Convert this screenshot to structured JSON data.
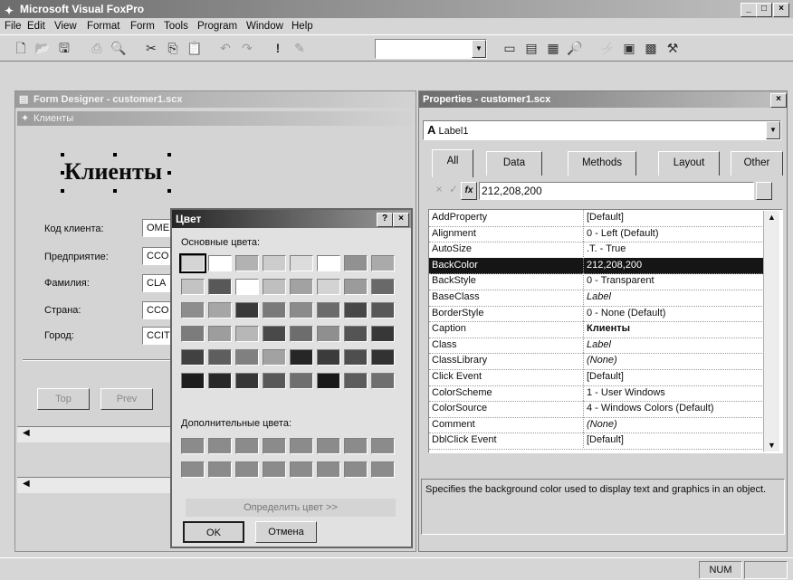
{
  "app": {
    "title": "Microsoft Visual FoxPro",
    "caption_buttons": [
      "_",
      "□",
      "×"
    ]
  },
  "menu": [
    "File",
    "Edit",
    "View",
    "Format",
    "Form",
    "Tools",
    "Program",
    "Window",
    "Help"
  ],
  "toolbar": {
    "icons": [
      "new-icon",
      "open-icon",
      "save-icon",
      "print-icon",
      "preview-icon",
      "cut-icon",
      "copy-icon",
      "paste-icon",
      "undo-icon",
      "redo-icon",
      "run-icon",
      "modify-icon"
    ],
    "combo_value": "",
    "right_icons": [
      "window-icon",
      "form-icon",
      "code-icon",
      "preview2-icon",
      "builder-icon",
      "data-env-icon",
      "properties-icon",
      "tools-icon"
    ]
  },
  "form_designer": {
    "title": "Form Designer - customer1.scx",
    "form_title": "Клиенты",
    "label_caption": "Клиенты",
    "fields": [
      {
        "label": "Код клиента:",
        "value": "OME"
      },
      {
        "label": "Предприятие:",
        "value": "CCO"
      },
      {
        "label": "Фамилия:",
        "value": "CLA"
      },
      {
        "label": "Страна:",
        "value": "CCO"
      },
      {
        "label": "Город:",
        "value": "CCIT"
      }
    ],
    "buttons": [
      "Top",
      "Prev"
    ]
  },
  "color_dialog": {
    "title": "Цвет",
    "help": "?",
    "close": "×",
    "basic_label": "Основные цвета:",
    "custom_label": "Дополнительные цвета:",
    "define_button": "Определить цвет >>",
    "ok": "OK",
    "cancel": "Отмена",
    "basic_colors": [
      "#d4d0c8",
      "#ffffff",
      "#b0b0b0",
      "#c8c8c8",
      "#d8d8d8",
      "#ffffff",
      "#909090",
      "#a8a8a8",
      "#c0c0c0",
      "#5a5a5a",
      "#ffffff",
      "#bcbcbc",
      "#a0a0a0",
      "#cfcfcf",
      "#9a9a9a",
      "#6a6a6a",
      "#8c8c8c",
      "#a4a4a4",
      "#3c3c3c",
      "#7a7a7a",
      "#8a8a8a",
      "#6c6c6c",
      "#4a4a4a",
      "#5a5a5a",
      "#7c7c7c",
      "#9c9c9c",
      "#b4b4b4",
      "#4c4c4c",
      "#6e6e6e",
      "#8e8e8e",
      "#565656",
      "#3a3a3a",
      "#444444",
      "#606060",
      "#808080",
      "#a0a0a0",
      "#2a2a2a",
      "#3e3e3e",
      "#505050",
      "#363636",
      "#222222",
      "#2c2c2c",
      "#3a3a3a",
      "#5a5a5a",
      "#707070",
      "#1e1e1e",
      "#5e5e5e",
      "#707070",
      "#888888",
      "#9c9c9c",
      "#e0e0e0",
      "#2e2e2e",
      "#ffffff",
      "#ffffff"
    ],
    "custom_colors": [
      "#8a8a8a",
      "#8a8a8a",
      "#8a8a8a",
      "#8a8a8a",
      "#8a8a8a",
      "#8a8a8a",
      "#8a8a8a",
      "#8a8a8a",
      "#8a8a8a",
      "#8a8a8a",
      "#8a8a8a",
      "#8a8a8a",
      "#8a8a8a",
      "#8a8a8a",
      "#8a8a8a",
      "#8a8a8a"
    ]
  },
  "properties": {
    "title": "Properties - customer1.scx",
    "object": "Label1",
    "object_icon": "A",
    "tabs": [
      "All",
      "Data",
      "Methods",
      "Layout",
      "Other"
    ],
    "edit_value": "212,208,200",
    "rows": [
      [
        "AddProperty",
        "[Default]"
      ],
      [
        "Alignment",
        "0 - Left (Default)"
      ],
      [
        "AutoSize",
        ".T. - True"
      ],
      [
        "BackColor",
        "212,208,200"
      ],
      [
        "BackStyle",
        "0 - Transparent"
      ],
      [
        "BaseClass",
        "Label"
      ],
      [
        "BorderStyle",
        "0 - None (Default)"
      ],
      [
        "Caption",
        "Клиенты"
      ],
      [
        "Class",
        "Label"
      ],
      [
        "ClassLibrary",
        "(None)"
      ],
      [
        "Click Event",
        "[Default]"
      ],
      [
        "ColorScheme",
        "1 - User Windows"
      ],
      [
        "ColorSource",
        "4 - Windows Colors (Default)"
      ],
      [
        "Comment",
        "(None)"
      ],
      [
        "DblClick Event",
        "[Default]"
      ]
    ],
    "selected_row": 3,
    "description": "Specifies the background color used to display text and graphics in an object."
  },
  "status": {
    "num": "NUM"
  }
}
